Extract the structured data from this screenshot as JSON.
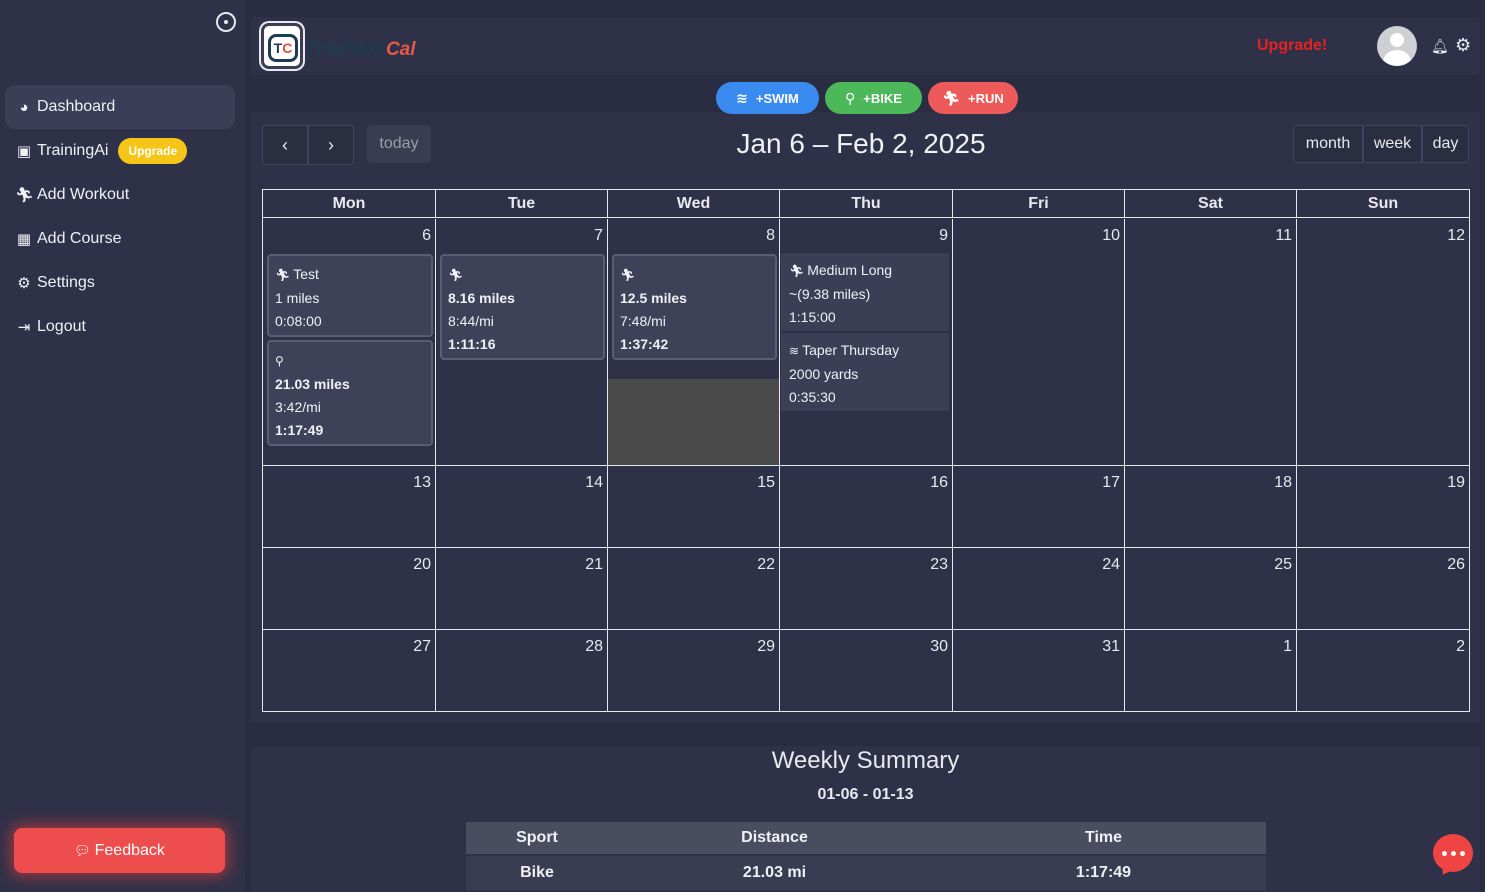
{
  "sidebar": {
    "items": [
      {
        "label": "Dashboard",
        "icon": "palette-icon"
      },
      {
        "label": "TrainingAi",
        "icon": "robot-icon",
        "badge": "Upgrade"
      },
      {
        "label": "Add Workout",
        "icon": "runner-icon"
      },
      {
        "label": "Add Course",
        "icon": "map-icon"
      },
      {
        "label": "Settings",
        "icon": "gear-icon"
      },
      {
        "label": "Logout",
        "icon": "logout-icon"
      }
    ],
    "feedback_label": "Feedback"
  },
  "header": {
    "logo_text_a": "Triathlon",
    "logo_text_b": "Cal",
    "logo_mark_a": "T",
    "logo_mark_b": "C",
    "upgrade_label": "Upgrade!"
  },
  "sport_buttons": [
    {
      "label": "+SWIM",
      "color": "#3a8bf0"
    },
    {
      "label": "+BIKE",
      "color": "#4cb85a"
    },
    {
      "label": "+RUN",
      "color": "#ee5a5a"
    }
  ],
  "toolbar": {
    "prev": "‹",
    "next": "›",
    "today": "today",
    "title": "Jan 6 – Feb 2, 2025",
    "views": [
      "month",
      "week",
      "day"
    ]
  },
  "calendar": {
    "weekdays": [
      "Mon",
      "Tue",
      "Wed",
      "Thu",
      "Fri",
      "Sat",
      "Sun"
    ],
    "weeks": [
      [
        "6",
        "7",
        "8",
        "9",
        "10",
        "11",
        "12"
      ],
      [
        "13",
        "14",
        "15",
        "16",
        "17",
        "18",
        "19"
      ],
      [
        "20",
        "21",
        "22",
        "23",
        "24",
        "25",
        "26"
      ],
      [
        "27",
        "28",
        "29",
        "30",
        "31",
        "1",
        "2"
      ]
    ],
    "events": {
      "mon_run": {
        "title": "Test",
        "distance": "1 miles",
        "time": "0:08:00"
      },
      "mon_bike": {
        "distance": "21.03 miles",
        "pace": "3:42/mi",
        "time": "1:17:49"
      },
      "tue_run": {
        "distance": "8.16 miles",
        "pace": "8:44/mi",
        "time": "1:11:16"
      },
      "wed_run": {
        "distance": "12.5 miles",
        "pace": "7:48/mi",
        "time": "1:37:42"
      },
      "thu_run": {
        "title": "Medium Long",
        "distance": "~(9.38 miles)",
        "time": "1:15:00"
      },
      "thu_swim": {
        "title": "Taper Thursday",
        "distance": "2000 yards",
        "time": "0:35:30"
      }
    }
  },
  "summary": {
    "title": "Weekly Summary",
    "range": "01-06 - 01-13",
    "columns": [
      "Sport",
      "Distance",
      "Time"
    ],
    "rows": [
      {
        "sport": "Bike",
        "distance": "21.03 mi",
        "time": "1:17:49"
      }
    ]
  }
}
